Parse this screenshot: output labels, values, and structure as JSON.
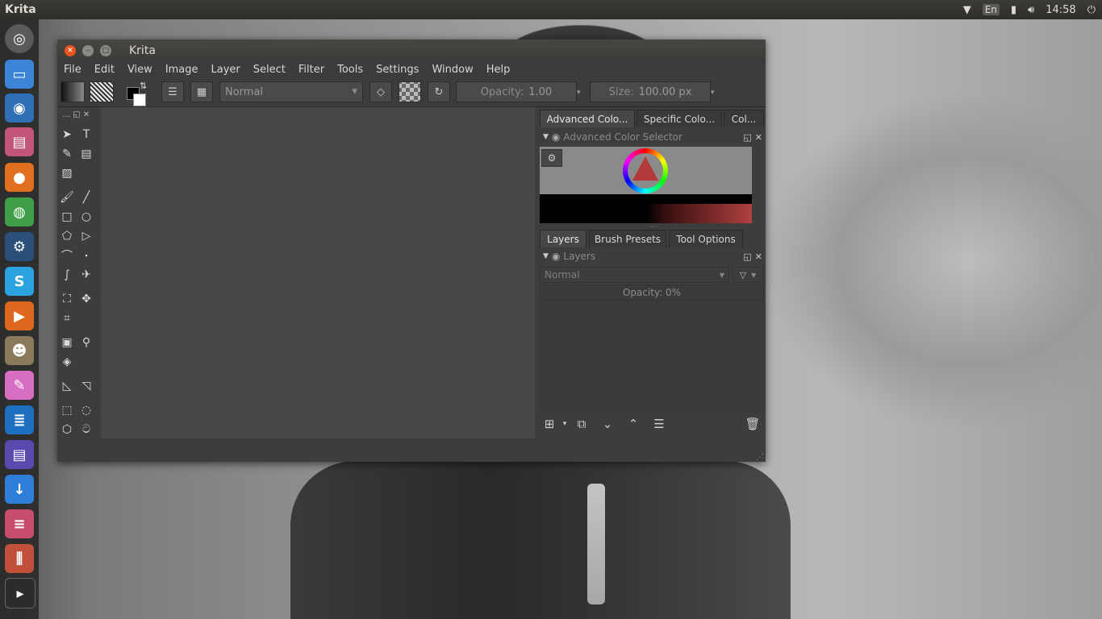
{
  "top_panel": {
    "app_name": "Krita",
    "keyboard_layout": "En",
    "clock": "14:58"
  },
  "window": {
    "title": "Krita"
  },
  "menu": [
    "File",
    "Edit",
    "View",
    "Image",
    "Layer",
    "Select",
    "Filter",
    "Tools",
    "Settings",
    "Window",
    "Help"
  ],
  "toolbar": {
    "blend_mode": "Normal",
    "opacity_label": "Opacity:",
    "opacity_value": "1.00",
    "size_label": "Size:",
    "size_value": "100.00 px"
  },
  "color_docker": {
    "tabs": [
      "Advanced Colo...",
      "Specific Colo...",
      "Col..."
    ],
    "title": "Advanced Color Selector"
  },
  "layers_docker": {
    "tabs": [
      "Layers",
      "Brush Presets",
      "Tool Options"
    ],
    "title": "Layers",
    "blend_mode": "Normal",
    "opacity": "Opacity:  0%"
  },
  "colors": {
    "accent_close": "#e95420",
    "foreground_color": "#000000",
    "background_color": "#ffffff"
  },
  "icons": {
    "launcher": [
      "ubuntu-dash-icon",
      "files-icon",
      "screenshot-icon",
      "file-manager-icon",
      "firefox-icon",
      "chrome-icon",
      "steam-icon",
      "skype-icon",
      "media-player-icon",
      "gimp-icon",
      "krita-icon",
      "writer-icon",
      "text-editor-icon",
      "downloader-icon",
      "settings-icon",
      "mixer-icon",
      "terminal-icon"
    ]
  }
}
